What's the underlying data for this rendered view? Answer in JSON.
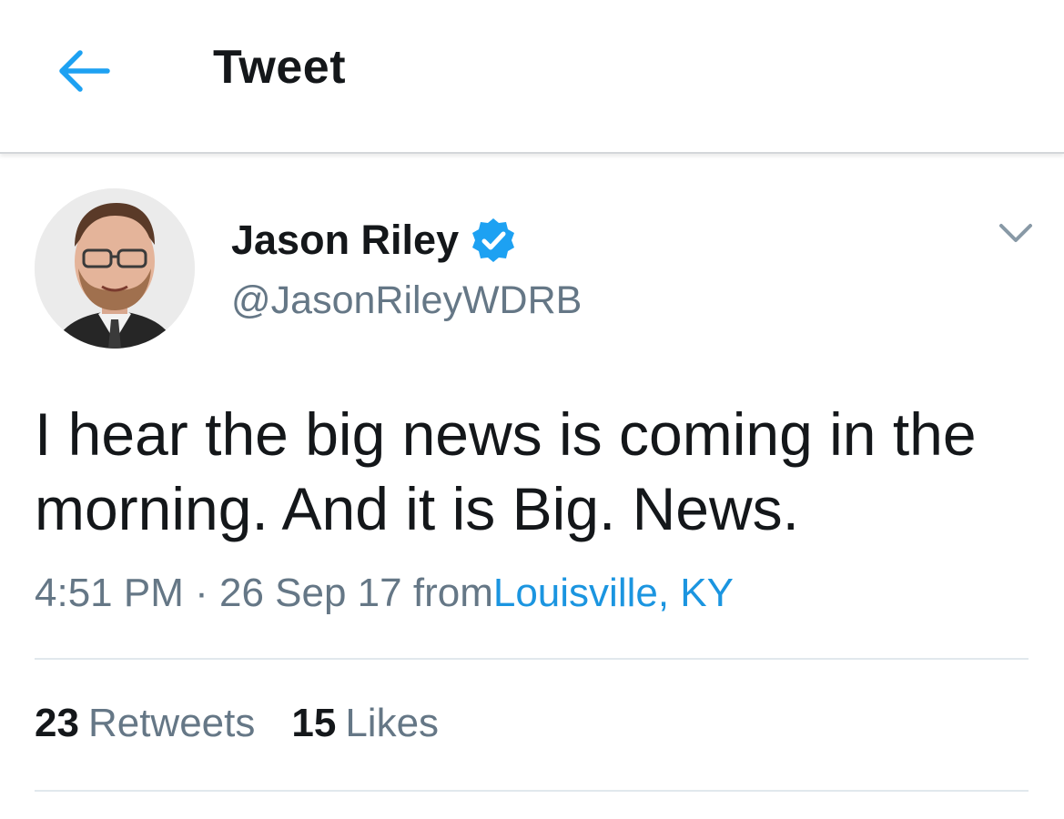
{
  "header": {
    "back_icon": "arrow-left-icon",
    "title": "Tweet"
  },
  "author": {
    "display_name": "Jason Riley",
    "verified_icon": "verified-badge-icon",
    "handle": "@JasonRileyWDRB",
    "menu_icon": "chevron-down-icon"
  },
  "tweet": {
    "text": "I hear the big news is coming in the morning. And it is Big. News.",
    "time": "4:51 PM",
    "separator": "·",
    "date": "26 Sep 17",
    "from_label": "from",
    "location": "Louisville, KY"
  },
  "stats": {
    "retweets_count": "23",
    "retweets_label": "Retweets",
    "likes_count": "15",
    "likes_label": "Likes"
  },
  "colors": {
    "accent": "#1da1f2",
    "link": "#1b95e0",
    "secondary_text": "#657786",
    "primary_text": "#14171a"
  }
}
